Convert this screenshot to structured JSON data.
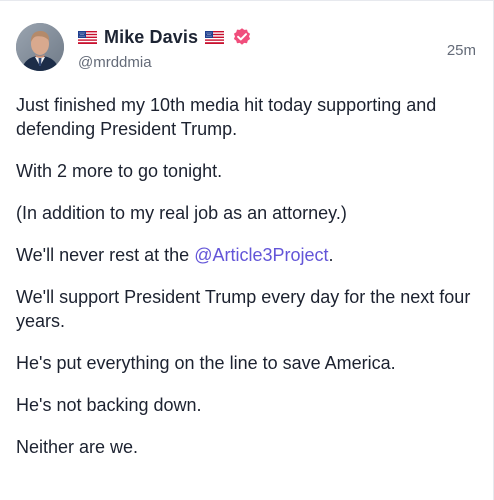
{
  "post": {
    "author": {
      "display_name": "Mike Davis",
      "handle": "@mrddmia",
      "prefix_icon": "us-flag-icon",
      "suffix_icon": "us-flag-icon",
      "verified_icon": "verified-badge-icon",
      "verified_color": "#f04e7c"
    },
    "timestamp": "25m",
    "body": {
      "p1": "Just finished my 10th media hit today supporting and defending President Trump.",
      "p2": "With 2 more to go tonight.",
      "p3": "(In addition to my real job as an attorney.)",
      "p4_before": "We'll never rest at the ",
      "p4_mention": "@Article3Project",
      "p4_after": ".",
      "p5": "We'll support President Trump every day for the next four years.",
      "p6": "He's put everything on the line to save America.",
      "p7": "He's not backing down.",
      "p8": "Neither are we."
    },
    "colors": {
      "mention": "#6355d8",
      "text": "#1c2230",
      "muted": "#646b78"
    }
  }
}
